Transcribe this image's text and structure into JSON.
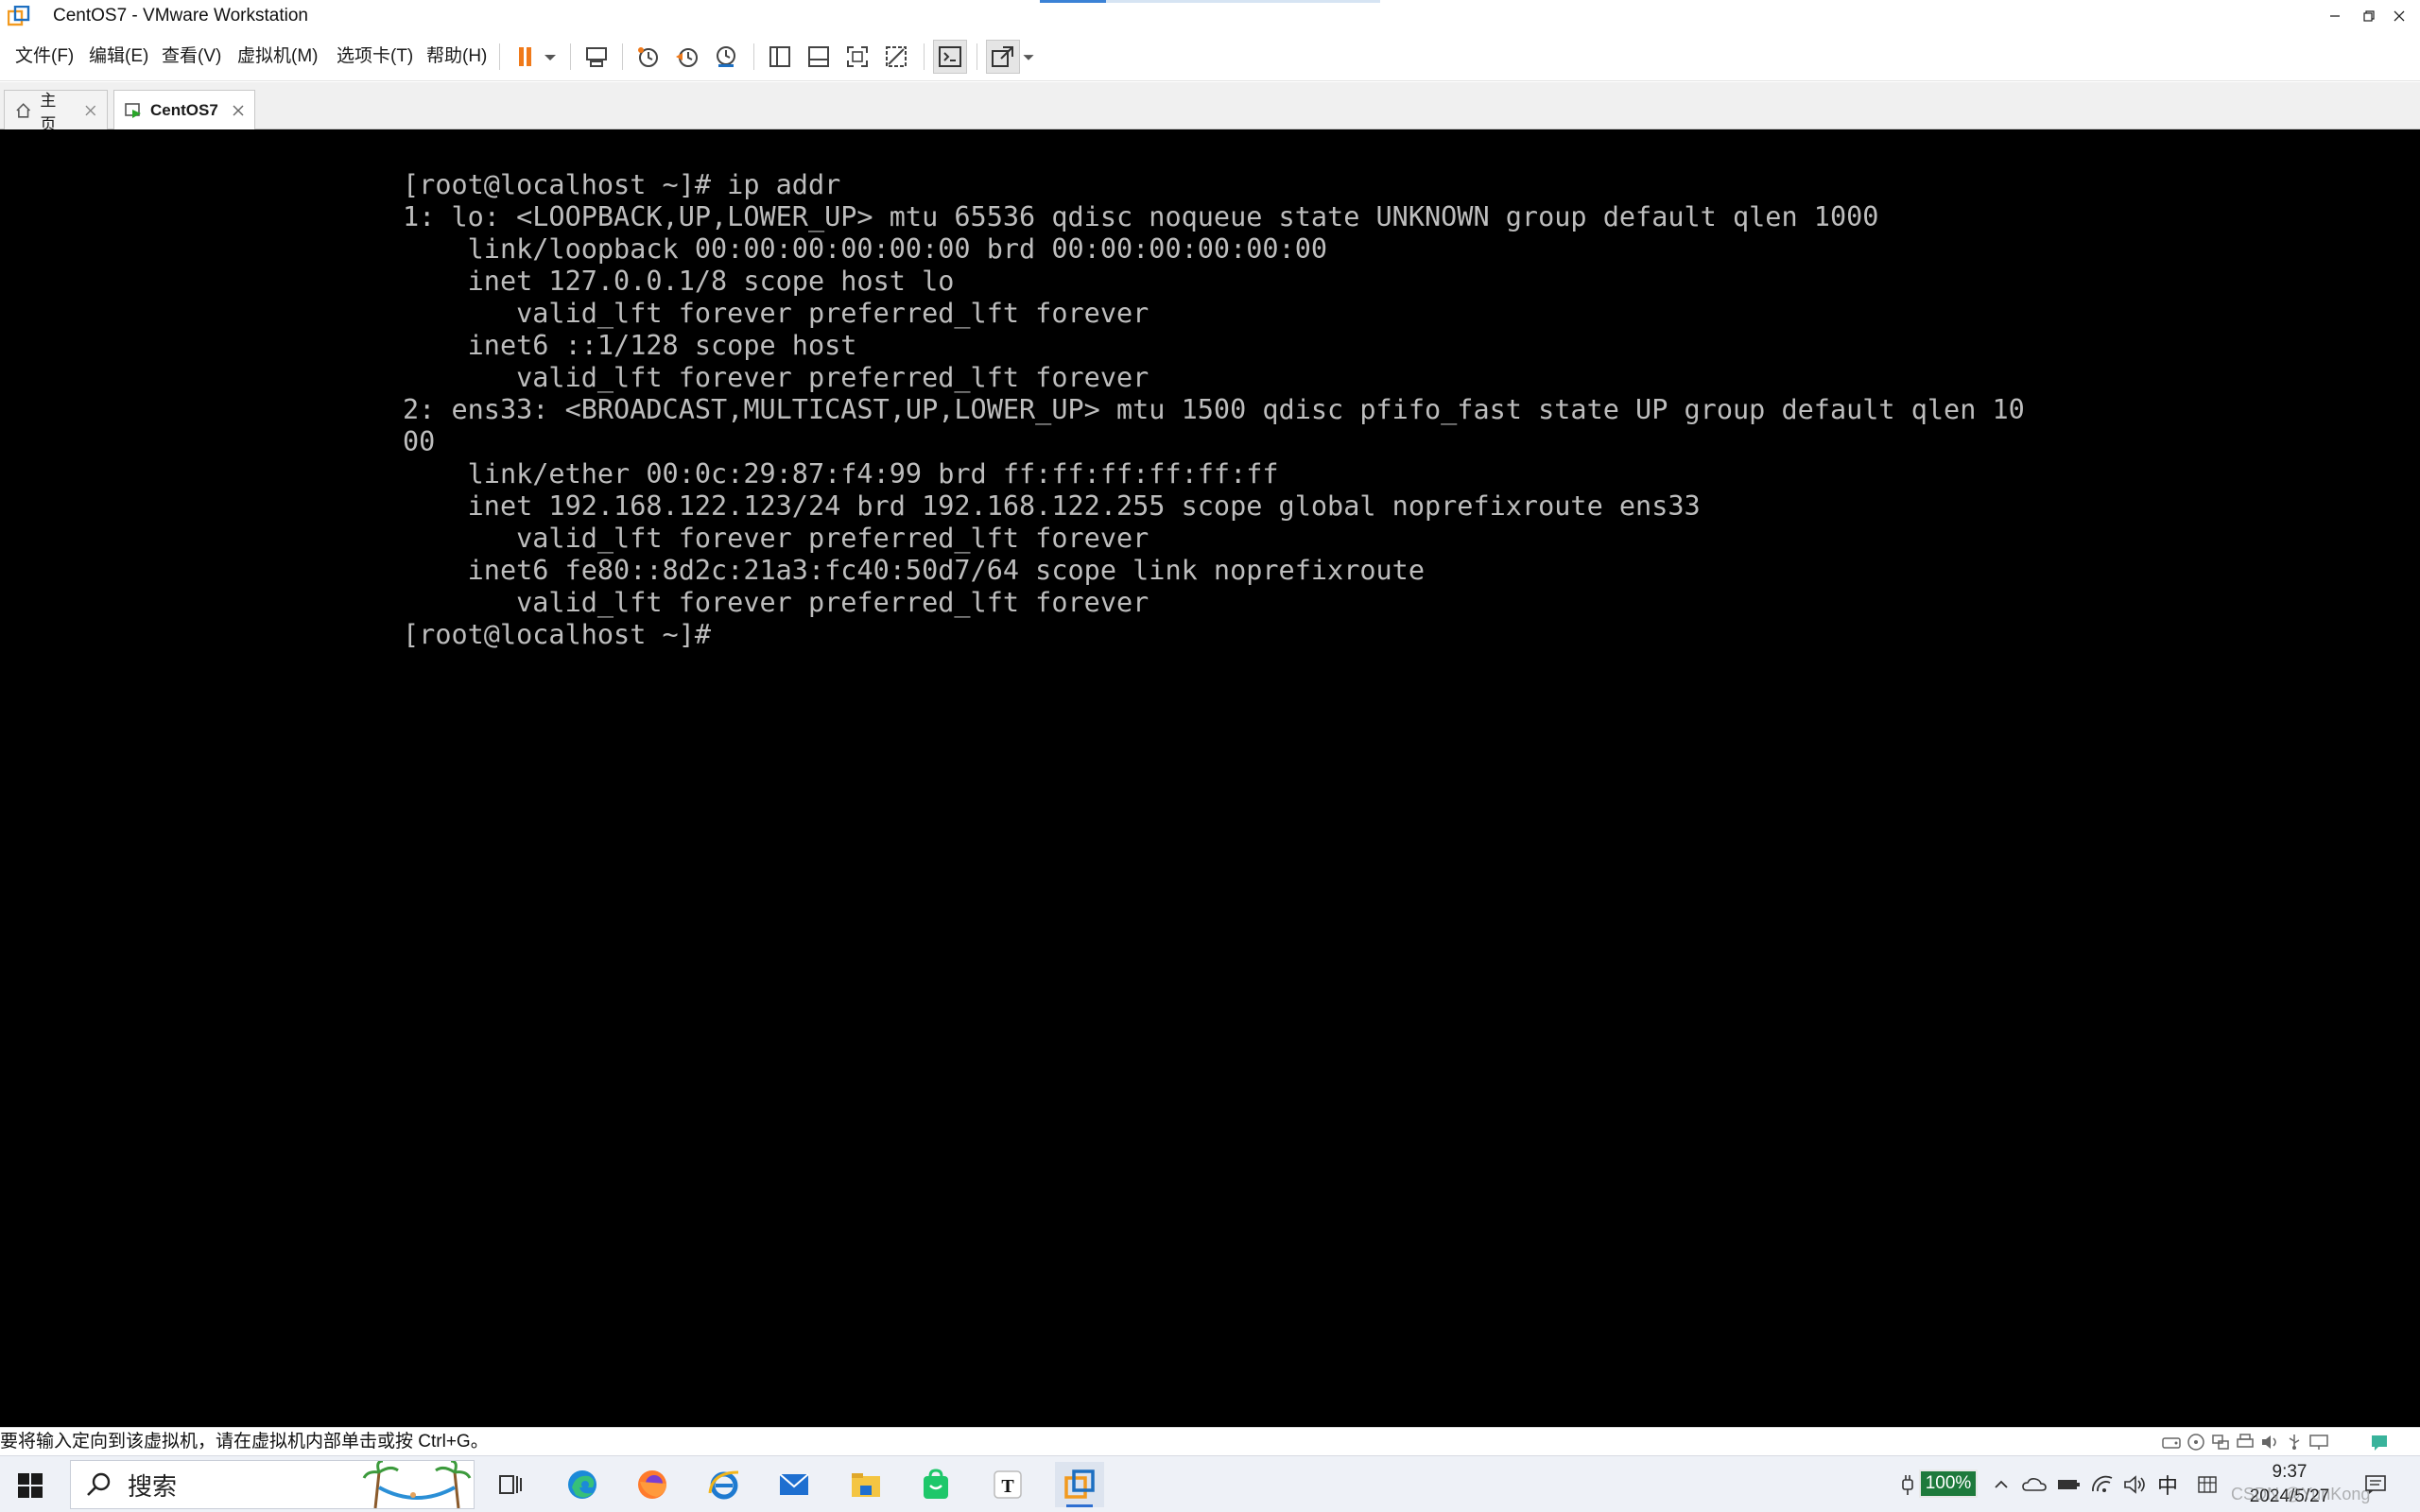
{
  "window": {
    "title": "CentOS7 - VMware Workstation",
    "icons": [
      "vmware-logo-icon",
      "minimize-icon",
      "restore-icon",
      "close-icon"
    ]
  },
  "menu": {
    "file": "文件(F)",
    "edit": "编辑(E)",
    "view": "查看(V)",
    "vm": "虚拟机(M)",
    "tabs": "选项卡(T)",
    "help": "帮助(H)"
  },
  "toolbar": {
    "icons": [
      "pause-icon",
      "dropdown-arrow-icon",
      "send-ctrl-alt-del-icon",
      "snapshot-icon",
      "revert-snapshot-icon",
      "snapshot-manager-icon",
      "library-icon",
      "thumbnail-bar-icon",
      "full-screen-icon",
      "unity-icon",
      "console-view-icon",
      "stretch-guest-icon"
    ]
  },
  "tabs": [
    {
      "label": "主页",
      "icon": "home-icon",
      "active": false
    },
    {
      "label": "CentOS7",
      "icon": "vm-running-icon",
      "active": true
    }
  ],
  "console": {
    "lines": [
      "[root@localhost ~]# ip addr",
      "1: lo: <LOOPBACK,UP,LOWER_UP> mtu 65536 qdisc noqueue state UNKNOWN group default qlen 1000",
      "    link/loopback 00:00:00:00:00:00 brd 00:00:00:00:00:00",
      "    inet 127.0.0.1/8 scope host lo",
      "       valid_lft forever preferred_lft forever",
      "    inet6 ::1/128 scope host",
      "       valid_lft forever preferred_lft forever",
      "2: ens33: <BROADCAST,MULTICAST,UP,LOWER_UP> mtu 1500 qdisc pfifo_fast state UP group default qlen 10",
      "00",
      "    link/ether 00:0c:29:87:f4:99 brd ff:ff:ff:ff:ff:ff",
      "    inet 192.168.122.123/24 brd 192.168.122.255 scope global noprefixroute ens33",
      "       valid_lft forever preferred_lft forever",
      "    inet6 fe80::8d2c:21a3:fc40:50d7/64 scope link noprefixroute",
      "       valid_lft forever preferred_lft forever",
      "[root@localhost ~]#"
    ]
  },
  "statusbar": {
    "hint": "要将输入定向到该虚拟机，请在虚拟机内部单击或按 Ctrl+G。",
    "device_icons": [
      "hard-disk-icon",
      "cd-dvd-icon",
      "network-adapter-icon",
      "printer-icon",
      "sound-icon",
      "usb-icon",
      "display-icon",
      "message-icon"
    ]
  },
  "taskbar": {
    "search_placeholder": "搜索",
    "apps": [
      "task-view-icon",
      "edge-icon",
      "firefox-icon",
      "ie-icon",
      "mail-icon",
      "file-explorer-icon",
      "store-icon",
      "typora-icon",
      "vmware-workstation-icon"
    ],
    "battery": "100%",
    "ime": "中",
    "time": "9:37",
    "date": "2024/5/27",
    "watermark": "CSDN @YunKong"
  },
  "colors": {
    "console_bg": "#000000",
    "console_fg": "#bdbdbd",
    "pause_orange": "#f07a1a",
    "battery_green": "#1e7a3c",
    "vmware_orange": "#f29a1f",
    "vmware_blue": "#1d6fc1"
  }
}
